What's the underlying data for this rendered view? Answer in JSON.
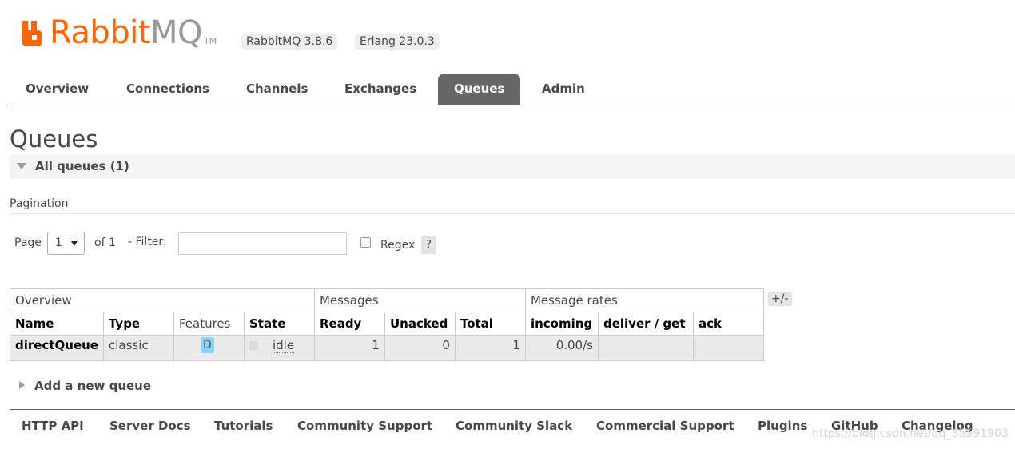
{
  "header": {
    "logo_rabbit": "Rabbit",
    "logo_mq": "MQ",
    "logo_tm": "TM",
    "rabbitmq_version": "RabbitMQ 3.8.6",
    "erlang_version": "Erlang 23.0.3"
  },
  "nav": {
    "tabs": [
      "Overview",
      "Connections",
      "Channels",
      "Exchanges",
      "Queues",
      "Admin"
    ],
    "active": "Queues"
  },
  "page": {
    "title": "Queues",
    "section_label": "All queues (1)",
    "pagination_label": "Pagination"
  },
  "pagination": {
    "page_word": "Page",
    "page_value": "1",
    "of_text": "of 1",
    "filter_label": "- Filter:",
    "filter_value": "",
    "regex_label": "Regex",
    "help": "?"
  },
  "table": {
    "groups": [
      "Overview",
      "Messages",
      "Message rates"
    ],
    "columns": [
      "Name",
      "Type",
      "Features",
      "State",
      "Ready",
      "Unacked",
      "Total",
      "incoming",
      "deliver / get",
      "ack"
    ],
    "rows": [
      {
        "name": "directQueue",
        "type": "classic",
        "features": "D",
        "state": "idle",
        "ready": "1",
        "unacked": "0",
        "total": "1",
        "incoming": "0.00/s",
        "deliver_get": "",
        "ack": ""
      }
    ],
    "toggle_columns": "+/-"
  },
  "add_queue_label": "Add a new queue",
  "footer": {
    "links": [
      "HTTP API",
      "Server Docs",
      "Tutorials",
      "Community Support",
      "Community Slack",
      "Commercial Support",
      "Plugins",
      "GitHub",
      "Changelog"
    ]
  },
  "watermark": "https://blog.csdn.net/qq_35591903",
  "colors": {
    "brand_orange": "#ff6600",
    "active_tab": "#666666",
    "feature_badge": "#88d4ff"
  }
}
